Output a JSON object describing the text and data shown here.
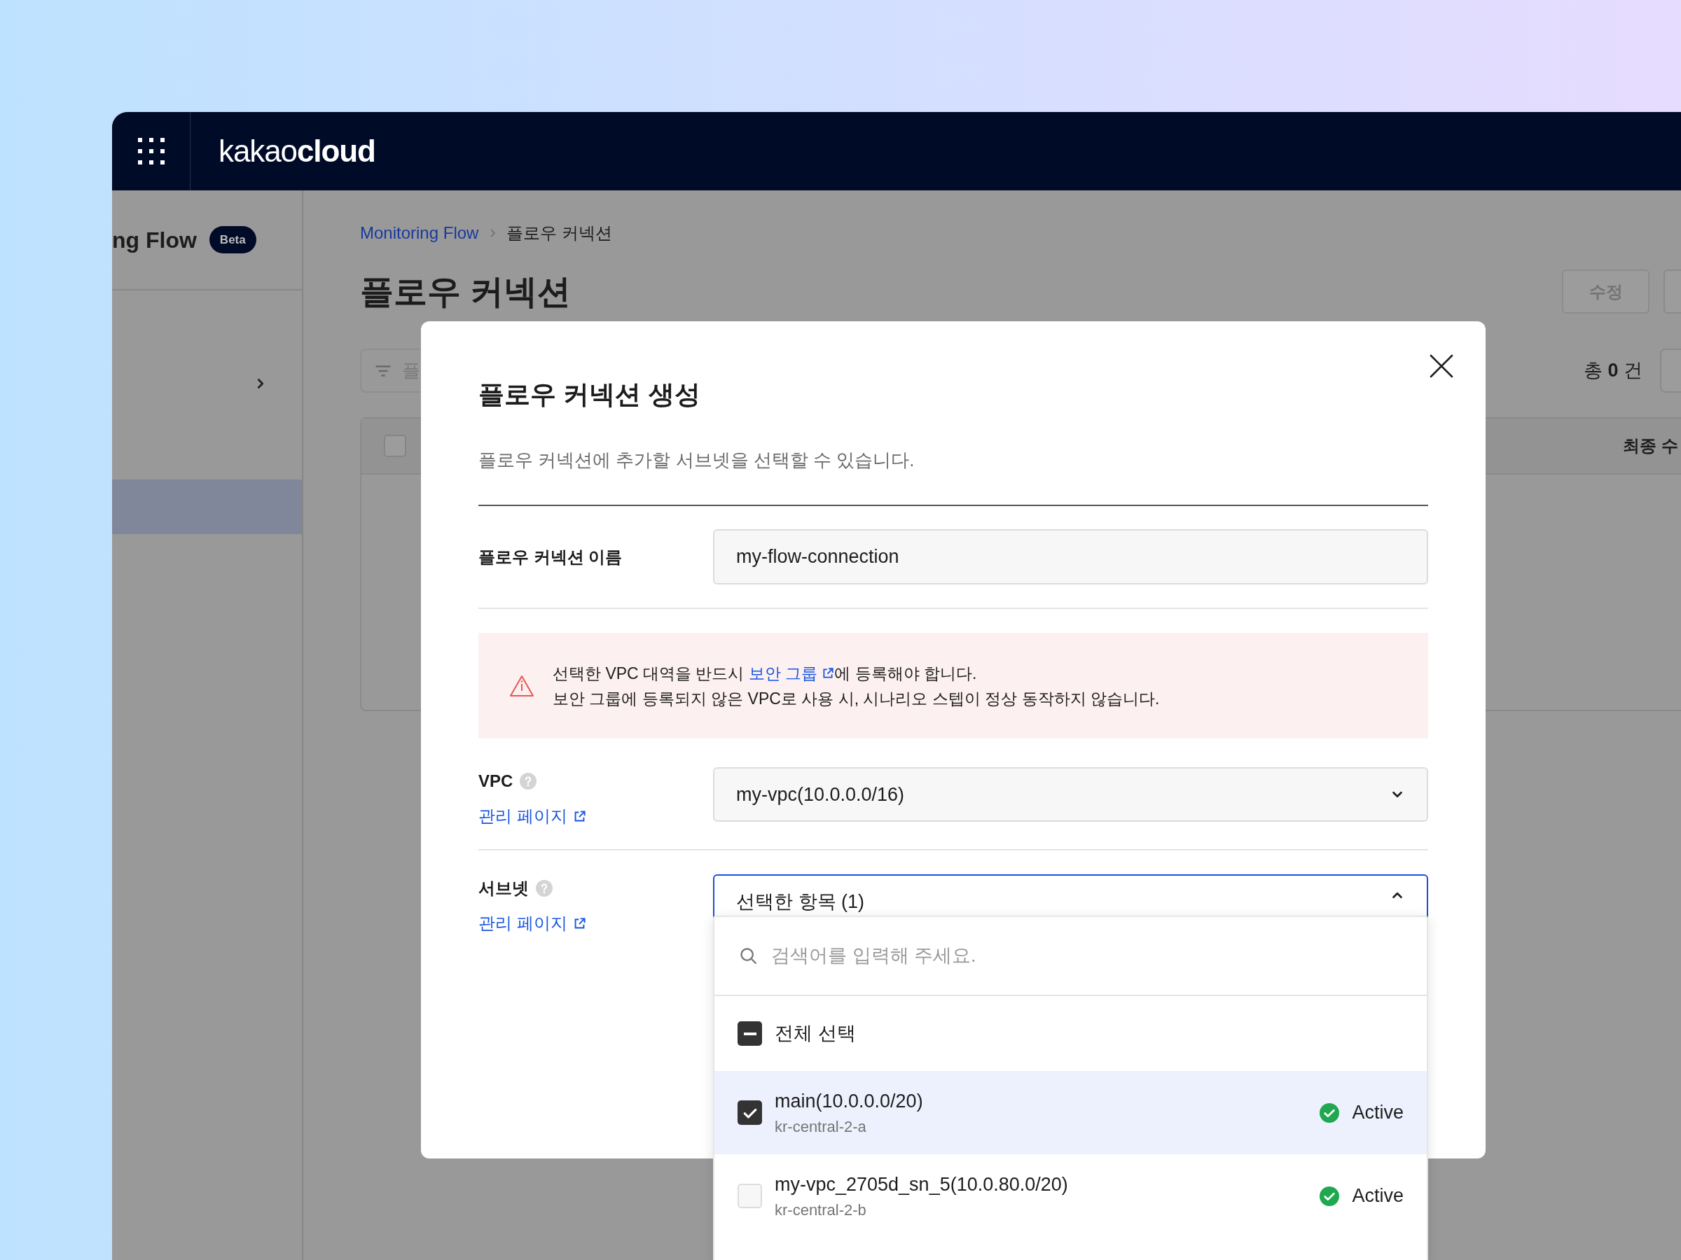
{
  "header": {
    "logo": "kakao**cloud**"
  },
  "sidebar": {
    "title": "ng Flow",
    "badge": "Beta",
    "items": [
      {
        "kind": "group",
        "expanded": false,
        "selected": false
      },
      {
        "kind": "item",
        "selected": true
      }
    ]
  },
  "page": {
    "breadcrumb": [
      {
        "kind": "link",
        "label": "Monitoring Flow"
      },
      {
        "kind": "current",
        "label": "플로우 커넥션"
      }
    ],
    "title": "플로우 커넥션",
    "buttons": [
      {
        "label": "수정",
        "disabled": true
      }
    ],
    "filter": {
      "placeholder": "플"
    },
    "count": "총 **0** 건",
    "table": {
      "header_checkbox": {
        "checked": false
      },
      "columns": [
        "최종 수"
      ]
    }
  },
  "modal": {
    "title": "플로우 커넥션 생성",
    "description": "플로우 커넥션에 추가할 서브넷을 선택할 수 있습니다.",
    "name_field": {
      "label": "플로우 커넥션 이름",
      "value": "my-flow-connection"
    },
    "warning": {
      "before": "선택한 VPC 대역을 반드시 ",
      "link": "보안 그룹",
      "after": "에 등록해야 합니다.",
      "line_2": "보안 그룹에 등록되지 않은 VPC로 사용 시, 시나리오 스텝이 정상 동작하지 않습니다."
    },
    "vpc": {
      "label": "VPC",
      "link": "관리 페이지",
      "value": "my-vpc(10.0.0.0/16)",
      "expanded": false
    },
    "subnet": {
      "label": "서브넷",
      "link": "관리 페이지",
      "value": "선택한 항목 (1)",
      "expanded": true,
      "dropdown": {
        "search_placeholder": "검색어를 입력해 주세요.",
        "select_all": {
          "label": "전체 선택",
          "indeterminate": true
        },
        "options": [
          {
            "name": "main(10.0.0.0/20)",
            "zone": "kr-central-2-a",
            "status": "Active",
            "checked": true
          },
          {
            "name": "my-vpc_2705d_sn_5(10.0.80.0/20)",
            "zone": "kr-central-2-b",
            "status": "Active",
            "checked": false
          }
        ]
      }
    }
  }
}
